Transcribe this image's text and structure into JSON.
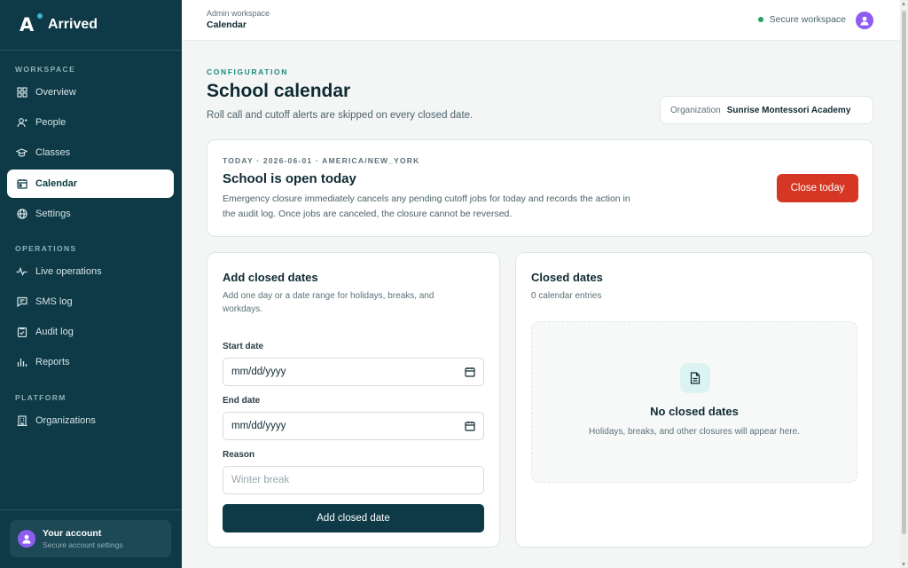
{
  "app": {
    "name": "Arrived"
  },
  "sidebar": {
    "sections": [
      {
        "label": "WORKSPACE",
        "items": [
          {
            "label": "Overview",
            "icon": "grid-icon"
          },
          {
            "label": "People",
            "icon": "person-icon"
          },
          {
            "label": "Classes",
            "icon": "graduation-cap-icon"
          },
          {
            "label": "Calendar",
            "icon": "calendar-icon",
            "active": true
          },
          {
            "label": "Settings",
            "icon": "globe-settings-icon"
          }
        ]
      },
      {
        "label": "OPERATIONS",
        "items": [
          {
            "label": "Live operations",
            "icon": "pulse-icon"
          },
          {
            "label": "SMS log",
            "icon": "message-icon"
          },
          {
            "label": "Audit log",
            "icon": "clipboard-icon"
          },
          {
            "label": "Reports",
            "icon": "bar-chart-icon"
          }
        ]
      },
      {
        "label": "PLATFORM",
        "items": [
          {
            "label": "Organizations",
            "icon": "building-icon"
          }
        ]
      }
    ],
    "account": {
      "name": "Your account",
      "sub": "Secure account settings"
    }
  },
  "header": {
    "breadcrumb_top": "Admin workspace",
    "breadcrumb_current": "Calendar",
    "status": "Secure workspace",
    "status_color": "#22a35a"
  },
  "page": {
    "eyebrow": "CONFIGURATION",
    "title": "School calendar",
    "subtitle": "Roll call and cutoff alerts are skipped on every closed date.",
    "org_label": "Organization",
    "org_value": "Sunrise Montessori Academy"
  },
  "today": {
    "meta": "TODAY · 2026-06-01 · AMERICA/NEW_YORK",
    "title": "School is open today",
    "description": "Emergency closure immediately cancels any pending cutoff jobs for today and records the action in the audit log. Once jobs are canceled, the closure cannot be reversed.",
    "button": "Close today",
    "button_color": "#d63624"
  },
  "add_form": {
    "title": "Add closed dates",
    "subtitle_line1": "Add one day or a date range for holidays, breaks, and",
    "subtitle_line2": "workdays.",
    "start_label": "Start date",
    "start_value": "mm/dd/yyyy",
    "end_label": "End date",
    "end_value": "mm/dd/yyyy",
    "reason_label": "Reason",
    "reason_placeholder": "Winter break",
    "submit": "Add closed date"
  },
  "closed_dates": {
    "title": "Closed dates",
    "count": "0 calendar entries",
    "empty_title": "No closed dates",
    "empty_sub": "Holidays, breaks, and other closures will appear here."
  },
  "colors": {
    "sidebar_bg": "#0d3a46",
    "accent": "#1c8a7e",
    "avatar": "#8f5cf2"
  }
}
